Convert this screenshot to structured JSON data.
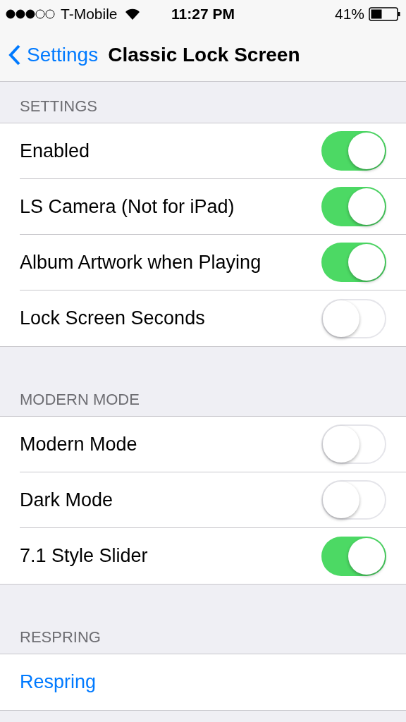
{
  "status_bar": {
    "carrier": "T-Mobile",
    "time": "11:27 PM",
    "battery": "41%"
  },
  "nav": {
    "back": "Settings",
    "title": "Classic Lock Screen"
  },
  "sections": [
    {
      "header": "SETTINGS",
      "rows": [
        {
          "kind": "toggle",
          "label": "Enabled",
          "on": true
        },
        {
          "kind": "toggle",
          "label": "LS Camera (Not for iPad)",
          "on": true
        },
        {
          "kind": "toggle",
          "label": "Album Artwork when Playing",
          "on": true
        },
        {
          "kind": "toggle",
          "label": "Lock Screen Seconds",
          "on": false
        }
      ]
    },
    {
      "header": "MODERN MODE",
      "rows": [
        {
          "kind": "toggle",
          "label": "Modern Mode",
          "on": false
        },
        {
          "kind": "toggle",
          "label": "Dark Mode",
          "on": false
        },
        {
          "kind": "toggle",
          "label": "7.1 Style Slider",
          "on": true
        }
      ]
    },
    {
      "header": "RESPRING",
      "rows": [
        {
          "kind": "action",
          "label": "Respring"
        }
      ]
    }
  ]
}
